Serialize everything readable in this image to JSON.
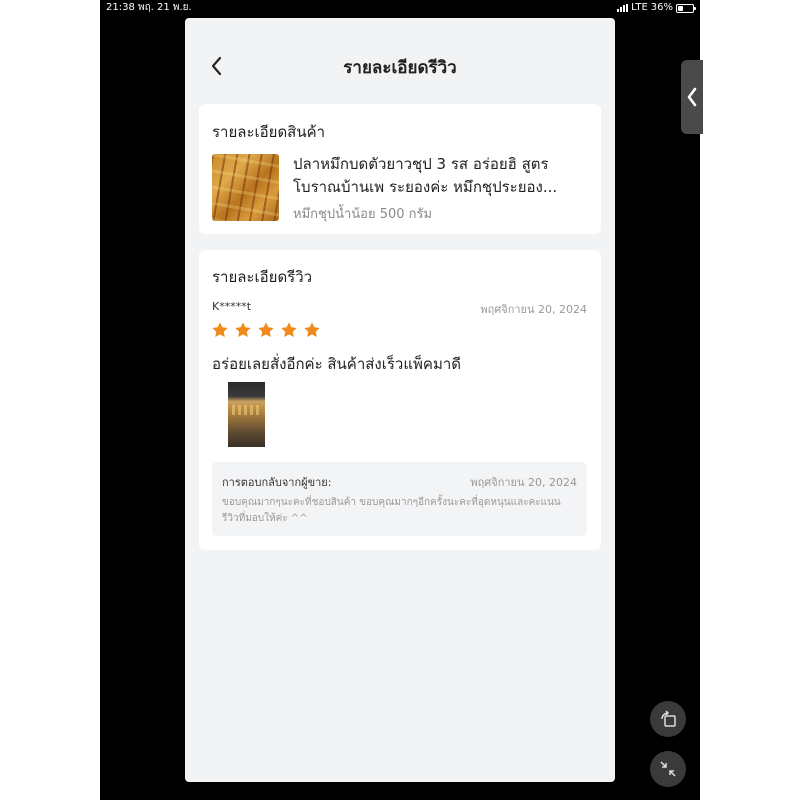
{
  "status_bar": {
    "time": "21:38",
    "date": "พฤ. 21 พ.ย.",
    "network": "LTE",
    "battery_percent": "36%",
    "battery_level": 0.36
  },
  "header": {
    "title": "รายละเอียดรีวิว"
  },
  "product_section": {
    "title": "รายละเอียดสินค้า",
    "name_line1": "ปลาหมึกบดตัวยาวชุป 3 รส อร่อยฮิ สูตร",
    "name_line2": "โบราณบ้านเพ ระยองค่ะ หมึกชุประยอง...",
    "variant": "หมึกชุปน้ำน้อย 500 กรัม"
  },
  "review_section": {
    "title": "รายละเอียดรีวิว",
    "reviewer": "K*****t",
    "date": "พฤศจิกายน 20, 2024",
    "rating": 5,
    "rating_max": 5,
    "text": "อร่อยเลยสั่งอีกค่ะ สินค้าส่งเร็วแพ็คมาดี",
    "seller_reply": {
      "label": "การตอบกลับจากผู้ขาย:",
      "date": "พฤศจิกายน 20, 2024",
      "text": "ขอบคุณมากๆนะคะที่ชอบสินค้า ขอบคุณมากๆอีกครั้งนะคะที่อุดหนุนและคะแนนรีวิวที่มอบให้ค่ะ ^^"
    }
  },
  "colors": {
    "star": "#f08a1c",
    "panel_background": "#f2f3f5",
    "card_background": "#ffffff",
    "outer_background": "#000000"
  },
  "icons": {
    "back": "chevron-left-icon",
    "star": "star-icon",
    "side_handle": "chevron-left-icon",
    "rotate": "rotate-icon",
    "collapse": "collapse-arrows-icon"
  }
}
